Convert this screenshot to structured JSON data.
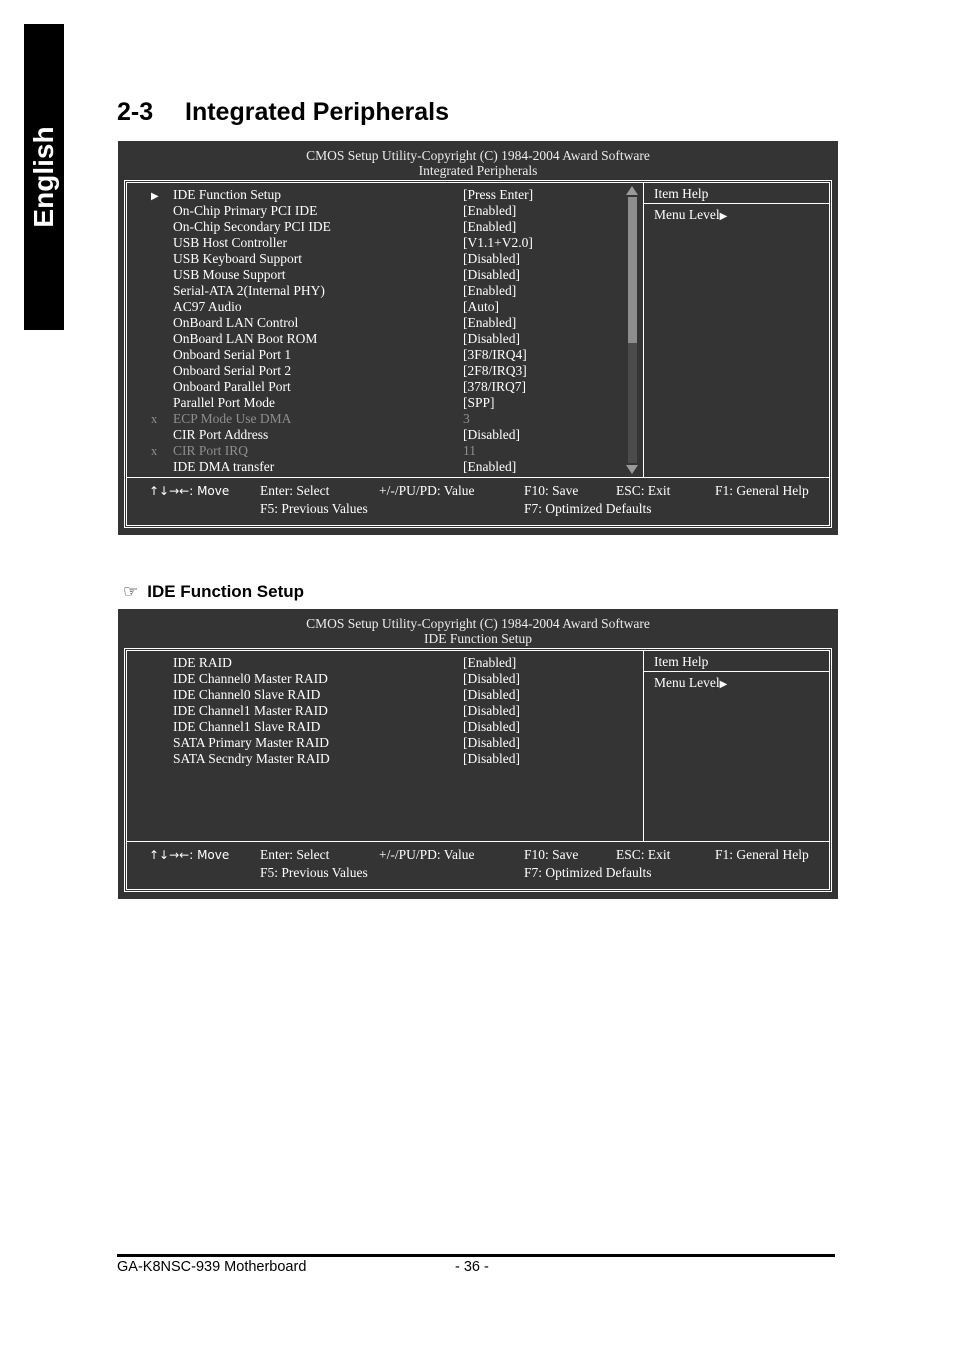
{
  "page": {
    "language_tab": "English",
    "section_number": "2-3",
    "section_title": "Integrated Peripherals",
    "sub_section_title": "IDE Function Setup",
    "hand_icon": "☞",
    "footer_product": "GA-K8NSC-939 Motherboard",
    "footer_page": "- 36 -"
  },
  "bios_common": {
    "copyright": "CMOS Setup Utility-Copyright (C) 1984-2004 Award Software",
    "help_title": "Item Help",
    "menu_level_label": "Menu Level",
    "menu_level_caret": "▶",
    "scroll_up_icon": "scroll-up-arrow",
    "scroll_down_icon": "scroll-down-arrow",
    "footer_keys": {
      "move": "↑↓→←: Move",
      "enter": "Enter: Select",
      "value": "+/-/PU/PD: Value",
      "save": "F10: Save",
      "esc": "ESC: Exit",
      "general_help": "F1: General Help",
      "previous": "F5: Previous Values",
      "optimized": "F7: Optimized Defaults"
    }
  },
  "screen1": {
    "subtitle": "Integrated Peripherals",
    "items": [
      {
        "mark": "▶",
        "mark_type": "arrow",
        "label": "IDE Function Setup",
        "value": "[Press Enter]",
        "dim": false
      },
      {
        "mark": "",
        "mark_type": "none",
        "label": "On-Chip Primary PCI IDE",
        "value": "[Enabled]",
        "dim": false
      },
      {
        "mark": "",
        "mark_type": "none",
        "label": "On-Chip Secondary PCI IDE",
        "value": "[Enabled]",
        "dim": false
      },
      {
        "mark": "",
        "mark_type": "none",
        "label": "USB Host Controller",
        "value": "[V1.1+V2.0]",
        "dim": false
      },
      {
        "mark": "",
        "mark_type": "none",
        "label": "USB Keyboard Support",
        "value": "[Disabled]",
        "dim": false
      },
      {
        "mark": "",
        "mark_type": "none",
        "label": "USB Mouse Support",
        "value": "[Disabled]",
        "dim": false
      },
      {
        "mark": "",
        "mark_type": "none",
        "label": "Serial-ATA 2(Internal PHY)",
        "value": "[Enabled]",
        "dim": false
      },
      {
        "mark": "",
        "mark_type": "none",
        "label": "AC97 Audio",
        "value": "[Auto]",
        "dim": false
      },
      {
        "mark": "",
        "mark_type": "none",
        "label": "OnBoard LAN Control",
        "value": "[Enabled]",
        "dim": false
      },
      {
        "mark": "",
        "mark_type": "none",
        "label": "OnBoard LAN Boot ROM",
        "value": "[Disabled]",
        "dim": false
      },
      {
        "mark": "",
        "mark_type": "none",
        "label": "Onboard Serial Port 1",
        "value": "[3F8/IRQ4]",
        "dim": false
      },
      {
        "mark": "",
        "mark_type": "none",
        "label": "Onboard Serial Port 2",
        "value": "[2F8/IRQ3]",
        "dim": false
      },
      {
        "mark": "",
        "mark_type": "none",
        "label": "Onboard Parallel Port",
        "value": "[378/IRQ7]",
        "dim": false
      },
      {
        "mark": "",
        "mark_type": "none",
        "label": "Parallel Port Mode",
        "value": "[SPP]",
        "dim": false
      },
      {
        "mark": "x",
        "mark_type": "x",
        "label": "ECP Mode Use DMA",
        "value": "3",
        "dim": true
      },
      {
        "mark": "",
        "mark_type": "none",
        "label": "CIR Port Address",
        "value": "[Disabled]",
        "dim": false
      },
      {
        "mark": "x",
        "mark_type": "x",
        "label": "CIR Port IRQ",
        "value": "11",
        "dim": true
      },
      {
        "mark": "",
        "mark_type": "none",
        "label": "IDE DMA transfer",
        "value": "[Enabled]",
        "dim": false
      }
    ],
    "scroll_thumb_percent": 55
  },
  "screen2": {
    "subtitle": "IDE Function Setup",
    "items": [
      {
        "mark": "",
        "mark_type": "none",
        "label": "IDE RAID",
        "value": "[Enabled]",
        "dim": false
      },
      {
        "mark": "",
        "mark_type": "none",
        "label": "IDE Channel0 Master RAID",
        "value": "[Disabled]",
        "dim": false
      },
      {
        "mark": "",
        "mark_type": "none",
        "label": "IDE Channel0 Slave RAID",
        "value": "[Disabled]",
        "dim": false
      },
      {
        "mark": "",
        "mark_type": "none",
        "label": "IDE Channel1 Master RAID",
        "value": "[Disabled]",
        "dim": false
      },
      {
        "mark": "",
        "mark_type": "none",
        "label": "IDE Channel1 Slave RAID",
        "value": "[Disabled]",
        "dim": false
      },
      {
        "mark": "",
        "mark_type": "none",
        "label": "SATA Primary Master RAID",
        "value": "[Disabled]",
        "dim": false
      },
      {
        "mark": "",
        "mark_type": "none",
        "label": "SATA Secndry Master RAID",
        "value": "[Disabled]",
        "dim": false
      }
    ]
  }
}
